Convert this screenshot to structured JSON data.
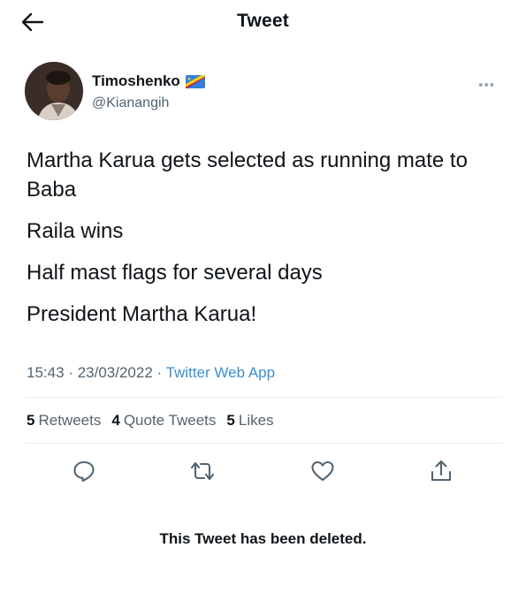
{
  "header": {
    "title": "Tweet",
    "back_icon": "arrow-left-icon"
  },
  "author": {
    "display_name": "Timoshenko",
    "handle": "@Kianangih",
    "badge_icon": "dr-congo-flag-icon",
    "more_icon": "more-dots-icon"
  },
  "tweet": {
    "lines": [
      "Martha Karua gets selected as running mate to Baba",
      "Raila wins",
      "Half mast flags for several days",
      "President Martha Karua!"
    ],
    "time": "15:43",
    "date": "23/03/2022",
    "separator": "·",
    "source": "Twitter Web App"
  },
  "stats": {
    "retweets_count": "5",
    "retweets_label": "Retweets",
    "quotes_count": "4",
    "quotes_label": "Quote Tweets",
    "likes_count": "5",
    "likes_label": "Likes"
  },
  "actions": [
    "reply-icon",
    "retweet-icon",
    "like-icon",
    "share-icon"
  ],
  "notice": "This Tweet has been deleted."
}
